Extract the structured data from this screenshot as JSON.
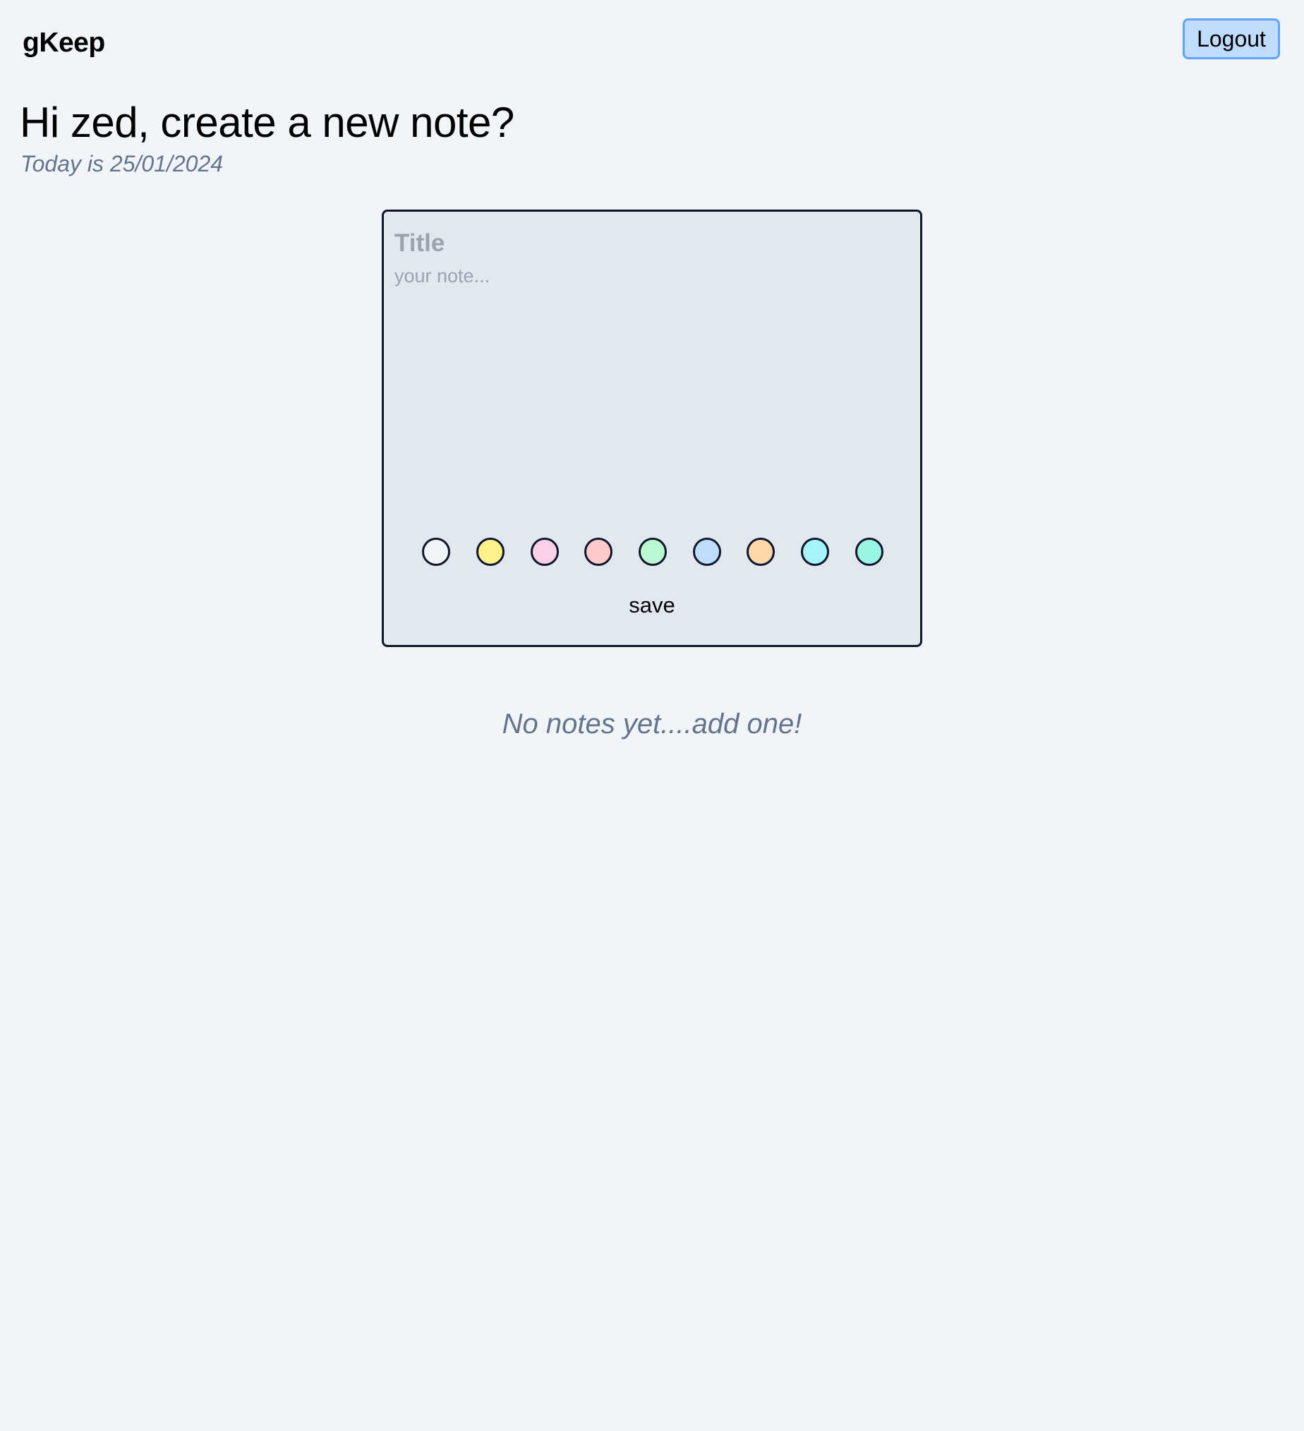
{
  "header": {
    "brand": "gKeep",
    "logout_label": "Logout"
  },
  "greeting": {
    "title": "Hi zed, create a new note?",
    "date_line": "Today is 25/01/2024"
  },
  "editor": {
    "title_placeholder": "Title",
    "title_value": "",
    "body_placeholder": "your note...",
    "body_value": "",
    "colors": [
      {
        "name": "white",
        "hex": "#f1f5f9"
      },
      {
        "name": "yellow",
        "hex": "#fef08a"
      },
      {
        "name": "pink",
        "hex": "#fbcfe8"
      },
      {
        "name": "red",
        "hex": "#fecaca"
      },
      {
        "name": "green",
        "hex": "#bbf7d0"
      },
      {
        "name": "blue",
        "hex": "#bfdbfe"
      },
      {
        "name": "orange",
        "hex": "#fed7aa"
      },
      {
        "name": "cyan",
        "hex": "#a5f3fc"
      },
      {
        "name": "teal",
        "hex": "#99f6e4"
      }
    ],
    "save_label": "save"
  },
  "notes": {
    "empty_message": "No notes yet....add one!"
  }
}
